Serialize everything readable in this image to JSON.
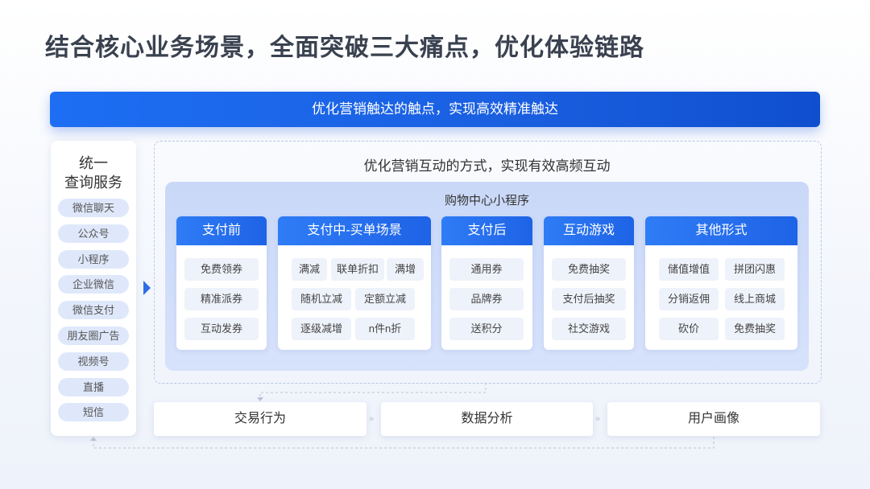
{
  "title": "结合核心业务场景，全面突破三大痛点，优化体验链路",
  "banner": "优化营销触达的触点，实现高效精准触达",
  "left_panel": {
    "title_line1": "统一",
    "title_line2": "查询服务",
    "items": [
      "微信聊天",
      "公众号",
      "小程序",
      "企业微信",
      "微信支付",
      "朋友圈广告",
      "视频号",
      "直播",
      "短信"
    ]
  },
  "interaction": {
    "subtitle": "优化营销互动的方式，实现有效高频互动",
    "mini_program_title": "购物中心小程序",
    "cards": [
      {
        "header": "支付前",
        "items": [
          "免费领券",
          "精准派券",
          "互动发券"
        ]
      },
      {
        "header": "支付中-买单场景",
        "items": [
          "满减",
          "联单折扣",
          "满增",
          "随机立减",
          "定额立减",
          "逐级减增",
          "n件n折"
        ]
      },
      {
        "header": "支付后",
        "items": [
          "通用券",
          "品牌券",
          "送积分"
        ]
      },
      {
        "header": "互动游戏",
        "items": [
          "免费抽奖",
          "支付后抽奖",
          "社交游戏"
        ]
      },
      {
        "header": "其他形式",
        "items": [
          "储值增值",
          "拼团闪惠",
          "分销返佣",
          "线上商城",
          "砍价",
          "免费抽奖"
        ]
      }
    ]
  },
  "bottom": [
    "交易行为",
    "数据分析",
    "用户画像"
  ],
  "colors": {
    "accent": "#1d6ef3",
    "chip_bg": "#eef2fa",
    "tag_bg": "#dfe8fb"
  },
  "icons": {
    "flow_arrow": "arrow-right-icon",
    "small_arrow": "double-chevron-right-icon"
  }
}
